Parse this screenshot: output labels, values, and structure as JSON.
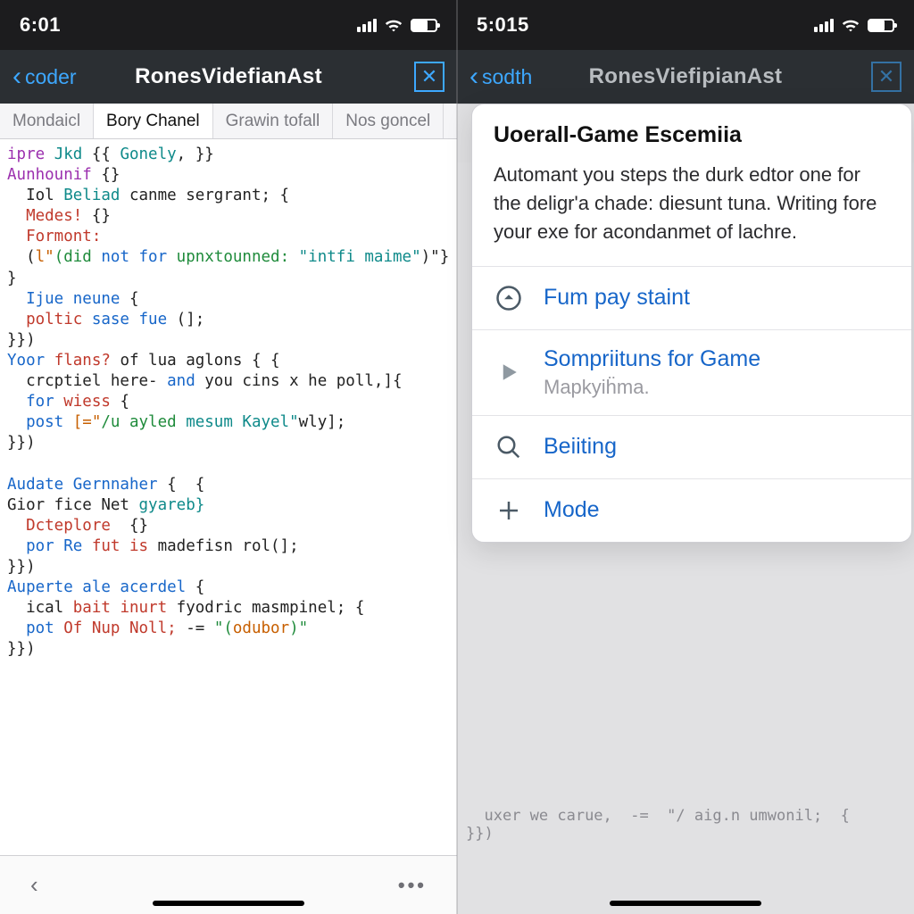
{
  "left": {
    "status_time": "6:01",
    "back_label": "coder",
    "title": "RonesVidefianAst",
    "tabs": [
      "Mondaicl",
      "Bory Chanel",
      "Grawin tofall",
      "Nos goncel"
    ],
    "active_tab_index": 1,
    "toolbar_more": "•••"
  },
  "right": {
    "status_time": "5:015",
    "back_label": "sodth",
    "title": "RonesViefipianAst",
    "toolbar_more": "•••",
    "ghost_line1": "uxer we carue,  -=  \"/ aig.n umwonil;  {",
    "ghost_line2": "}})",
    "sheet": {
      "title": "Uoerall-Game Escemiia",
      "desc": "Automant you steps the durk edtor one for the deligr'a chade: diesunt tuna. Writing fore your exe for acondanmet of lachre.",
      "items": [
        {
          "icon": "circle-up-icon",
          "label": "Fum pay staint",
          "sub": ""
        },
        {
          "icon": "play-icon",
          "label": "Sompriituns for Game",
          "sub": "Mapkyiḧma."
        },
        {
          "icon": "search-icon",
          "label": "Beiiting",
          "sub": ""
        },
        {
          "icon": "plus-icon",
          "label": "Mode",
          "sub": ""
        }
      ]
    }
  },
  "code": {
    "l1a": "ipre ",
    "l1b": "Jkd",
    "l1c": " {{ ",
    "l1d": "Gonely",
    "l1e": ", }}",
    "l2a": "Aunhounif",
    "l2b": " {}",
    "l3a": "  Iol ",
    "l3b": "Beliad",
    "l3c": " canme sergrant; {",
    "l4a": "  Medes!",
    "l4b": " {}",
    "l5a": "  Formont:",
    "l6a": "  (",
    "l6b": "l\"",
    "l6c": "(did ",
    "l6d": "not for ",
    "l6e": "upnxtounned:",
    "l6f": " \"intfi maime\"",
    "l6g": ")\"}",
    "l7": "}",
    "l8a": "  Ijue neune",
    "l8b": " {",
    "l9a": "  poltic ",
    "l9b": "sase fue ",
    "l9c": "(];",
    "l10": "}})",
    "l11a": "Yoor ",
    "l11b": "flans?",
    "l11c": " of lua aglons { {",
    "l12a": "  crcptiel here- ",
    "l12b": "and",
    "l12c": " you cins x he poll,]{",
    "l13a": "  for ",
    "l13b": "wiess ",
    "l13c": "{",
    "l14a": "  post ",
    "l14b": "[=\"",
    "l14c": "/u ayled ",
    "l14d": "mesum Kayel\"",
    "l14e": "wly];",
    "l15": "}})",
    "l16": "",
    "l17a": "Audate Gernnaher",
    "l17b": " {  {",
    "l18a": "Gior fice Net ",
    "l18b": "gyareb}",
    "l19a": "  Dcteplore",
    "l19b": "  {}",
    "l20a": "  por Re ",
    "l20b": "fut is ",
    "l20c": "madefisn rol(];",
    "l21": "}})",
    "l22a": "Auperte ale acerdel",
    "l22b": " {",
    "l23a": "  ical ",
    "l23b": "bait inurt ",
    "l23c": "fyodric masmpinel; {",
    "l24a": "  pot ",
    "l24b": "Of Nup Noll;",
    "l24c": " -= ",
    "l24d": "\"(",
    "l24e": "odubor",
    "l24f": ")\"",
    "l25": "}})"
  }
}
